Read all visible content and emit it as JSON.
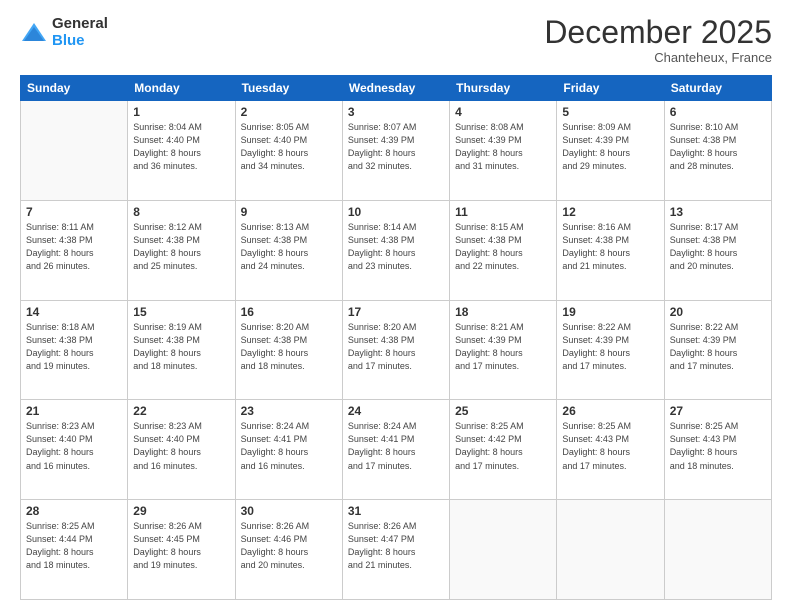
{
  "logo": {
    "general": "General",
    "blue": "Blue"
  },
  "header": {
    "month": "December 2025",
    "location": "Chanteheux, France"
  },
  "days_of_week": [
    "Sunday",
    "Monday",
    "Tuesday",
    "Wednesday",
    "Thursday",
    "Friday",
    "Saturday"
  ],
  "weeks": [
    [
      {
        "day": "",
        "sunrise": "",
        "sunset": "",
        "daylight": ""
      },
      {
        "day": "1",
        "sunrise": "Sunrise: 8:04 AM",
        "sunset": "Sunset: 4:40 PM",
        "daylight": "Daylight: 8 hours and 36 minutes."
      },
      {
        "day": "2",
        "sunrise": "Sunrise: 8:05 AM",
        "sunset": "Sunset: 4:40 PM",
        "daylight": "Daylight: 8 hours and 34 minutes."
      },
      {
        "day": "3",
        "sunrise": "Sunrise: 8:07 AM",
        "sunset": "Sunset: 4:39 PM",
        "daylight": "Daylight: 8 hours and 32 minutes."
      },
      {
        "day": "4",
        "sunrise": "Sunrise: 8:08 AM",
        "sunset": "Sunset: 4:39 PM",
        "daylight": "Daylight: 8 hours and 31 minutes."
      },
      {
        "day": "5",
        "sunrise": "Sunrise: 8:09 AM",
        "sunset": "Sunset: 4:39 PM",
        "daylight": "Daylight: 8 hours and 29 minutes."
      },
      {
        "day": "6",
        "sunrise": "Sunrise: 8:10 AM",
        "sunset": "Sunset: 4:38 PM",
        "daylight": "Daylight: 8 hours and 28 minutes."
      }
    ],
    [
      {
        "day": "7",
        "sunrise": "Sunrise: 8:11 AM",
        "sunset": "Sunset: 4:38 PM",
        "daylight": "Daylight: 8 hours and 26 minutes."
      },
      {
        "day": "8",
        "sunrise": "Sunrise: 8:12 AM",
        "sunset": "Sunset: 4:38 PM",
        "daylight": "Daylight: 8 hours and 25 minutes."
      },
      {
        "day": "9",
        "sunrise": "Sunrise: 8:13 AM",
        "sunset": "Sunset: 4:38 PM",
        "daylight": "Daylight: 8 hours and 24 minutes."
      },
      {
        "day": "10",
        "sunrise": "Sunrise: 8:14 AM",
        "sunset": "Sunset: 4:38 PM",
        "daylight": "Daylight: 8 hours and 23 minutes."
      },
      {
        "day": "11",
        "sunrise": "Sunrise: 8:15 AM",
        "sunset": "Sunset: 4:38 PM",
        "daylight": "Daylight: 8 hours and 22 minutes."
      },
      {
        "day": "12",
        "sunrise": "Sunrise: 8:16 AM",
        "sunset": "Sunset: 4:38 PM",
        "daylight": "Daylight: 8 hours and 21 minutes."
      },
      {
        "day": "13",
        "sunrise": "Sunrise: 8:17 AM",
        "sunset": "Sunset: 4:38 PM",
        "daylight": "Daylight: 8 hours and 20 minutes."
      }
    ],
    [
      {
        "day": "14",
        "sunrise": "Sunrise: 8:18 AM",
        "sunset": "Sunset: 4:38 PM",
        "daylight": "Daylight: 8 hours and 19 minutes."
      },
      {
        "day": "15",
        "sunrise": "Sunrise: 8:19 AM",
        "sunset": "Sunset: 4:38 PM",
        "daylight": "Daylight: 8 hours and 18 minutes."
      },
      {
        "day": "16",
        "sunrise": "Sunrise: 8:20 AM",
        "sunset": "Sunset: 4:38 PM",
        "daylight": "Daylight: 8 hours and 18 minutes."
      },
      {
        "day": "17",
        "sunrise": "Sunrise: 8:20 AM",
        "sunset": "Sunset: 4:38 PM",
        "daylight": "Daylight: 8 hours and 17 minutes."
      },
      {
        "day": "18",
        "sunrise": "Sunrise: 8:21 AM",
        "sunset": "Sunset: 4:39 PM",
        "daylight": "Daylight: 8 hours and 17 minutes."
      },
      {
        "day": "19",
        "sunrise": "Sunrise: 8:22 AM",
        "sunset": "Sunset: 4:39 PM",
        "daylight": "Daylight: 8 hours and 17 minutes."
      },
      {
        "day": "20",
        "sunrise": "Sunrise: 8:22 AM",
        "sunset": "Sunset: 4:39 PM",
        "daylight": "Daylight: 8 hours and 17 minutes."
      }
    ],
    [
      {
        "day": "21",
        "sunrise": "Sunrise: 8:23 AM",
        "sunset": "Sunset: 4:40 PM",
        "daylight": "Daylight: 8 hours and 16 minutes."
      },
      {
        "day": "22",
        "sunrise": "Sunrise: 8:23 AM",
        "sunset": "Sunset: 4:40 PM",
        "daylight": "Daylight: 8 hours and 16 minutes."
      },
      {
        "day": "23",
        "sunrise": "Sunrise: 8:24 AM",
        "sunset": "Sunset: 4:41 PM",
        "daylight": "Daylight: 8 hours and 16 minutes."
      },
      {
        "day": "24",
        "sunrise": "Sunrise: 8:24 AM",
        "sunset": "Sunset: 4:41 PM",
        "daylight": "Daylight: 8 hours and 17 minutes."
      },
      {
        "day": "25",
        "sunrise": "Sunrise: 8:25 AM",
        "sunset": "Sunset: 4:42 PM",
        "daylight": "Daylight: 8 hours and 17 minutes."
      },
      {
        "day": "26",
        "sunrise": "Sunrise: 8:25 AM",
        "sunset": "Sunset: 4:43 PM",
        "daylight": "Daylight: 8 hours and 17 minutes."
      },
      {
        "day": "27",
        "sunrise": "Sunrise: 8:25 AM",
        "sunset": "Sunset: 4:43 PM",
        "daylight": "Daylight: 8 hours and 18 minutes."
      }
    ],
    [
      {
        "day": "28",
        "sunrise": "Sunrise: 8:25 AM",
        "sunset": "Sunset: 4:44 PM",
        "daylight": "Daylight: 8 hours and 18 minutes."
      },
      {
        "day": "29",
        "sunrise": "Sunrise: 8:26 AM",
        "sunset": "Sunset: 4:45 PM",
        "daylight": "Daylight: 8 hours and 19 minutes."
      },
      {
        "day": "30",
        "sunrise": "Sunrise: 8:26 AM",
        "sunset": "Sunset: 4:46 PM",
        "daylight": "Daylight: 8 hours and 20 minutes."
      },
      {
        "day": "31",
        "sunrise": "Sunrise: 8:26 AM",
        "sunset": "Sunset: 4:47 PM",
        "daylight": "Daylight: 8 hours and 21 minutes."
      },
      {
        "day": "",
        "sunrise": "",
        "sunset": "",
        "daylight": ""
      },
      {
        "day": "",
        "sunrise": "",
        "sunset": "",
        "daylight": ""
      },
      {
        "day": "",
        "sunrise": "",
        "sunset": "",
        "daylight": ""
      }
    ]
  ]
}
